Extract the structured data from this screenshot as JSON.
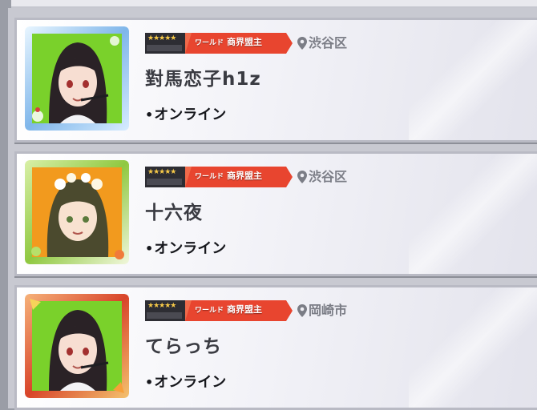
{
  "players": [
    {
      "name": "對馬恋子h1z",
      "status": "オンライン",
      "location": "渋谷区",
      "title_prefix": "ワールド",
      "title_main": "商界盟主",
      "stars": "★★★★★",
      "frame_style": "ice-blue",
      "avatar_bg": "#7ad12b",
      "hair_color": "#2a2226"
    },
    {
      "name": "十六夜",
      "status": "オンライン",
      "location": "渋谷区",
      "title_prefix": "ワールド",
      "title_main": "商界盟主",
      "stars": "★★★★★",
      "frame_style": "floral-green",
      "avatar_bg": "#f29a1e",
      "hair_color": "#4b4a2e"
    },
    {
      "name": "てらっち",
      "status": "オンライン",
      "location": "岡崎市",
      "title_prefix": "ワールド",
      "title_main": "商界盟主",
      "stars": "★★★★★",
      "frame_style": "autumn-red",
      "avatar_bg": "#7ad12b",
      "hair_color": "#2a2226"
    }
  ],
  "colors": {
    "badge_red": "#e8452f",
    "badge_dark": "#2d2d33",
    "location_gray": "#7b7d86",
    "name_color": "#3a3b42"
  }
}
